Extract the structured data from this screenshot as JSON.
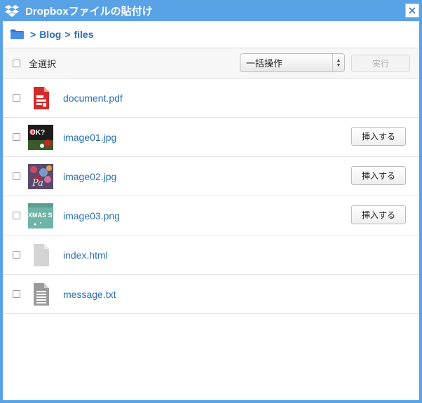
{
  "window": {
    "title": "Dropboxファイルの貼付け",
    "close_glyph": "✕"
  },
  "breadcrumb": {
    "separator": ">",
    "items": [
      "Blog",
      "files"
    ]
  },
  "toolbar": {
    "select_all_label": "全選択",
    "bulk_action_selected": "一括操作",
    "run_label": "実行"
  },
  "files": [
    {
      "name": "document.pdf",
      "type": "pdf",
      "insert_label": ""
    },
    {
      "name": "image01.jpg",
      "type": "image",
      "insert_label": "挿入する",
      "thumb_text": "OK?"
    },
    {
      "name": "image02.jpg",
      "type": "image",
      "insert_label": "挿入する",
      "thumb_text": "Pa"
    },
    {
      "name": "image03.png",
      "type": "image",
      "insert_label": "挿入する",
      "thumb_text": "XMAS S"
    },
    {
      "name": "index.html",
      "type": "html",
      "insert_label": ""
    },
    {
      "name": "message.txt",
      "type": "txt",
      "insert_label": ""
    }
  ],
  "colors": {
    "frame": "#5aa2e6",
    "link": "#2a6fb8",
    "pdf_red": "#d42a2a"
  }
}
